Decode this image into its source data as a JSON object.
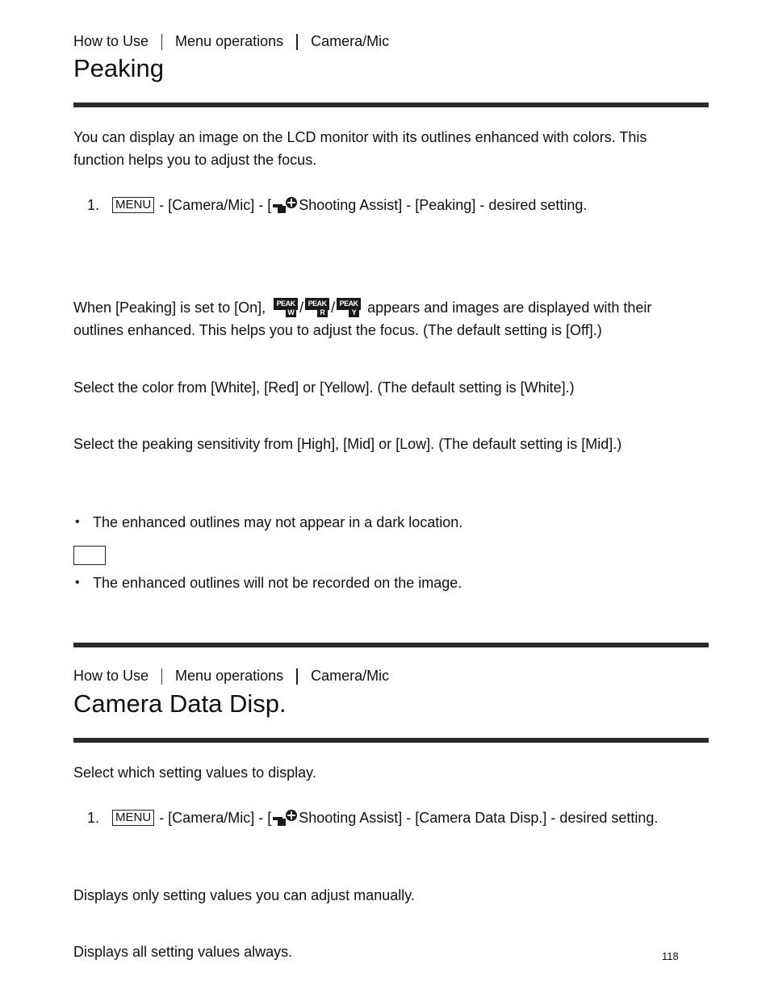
{
  "section1": {
    "breadcrumb": [
      "How to Use",
      "Menu operations",
      "Camera/Mic"
    ],
    "title": "Peaking",
    "intro_line1": "You can display an image on the LCD monitor with its outlines enhanced with colors. This",
    "intro_line2": "function helps you to adjust the focus.",
    "step": {
      "number": "1.",
      "menu_key": "MENU",
      "text_before_icon": "- [Camera/Mic] - [",
      "icon": "shooting-assist-icon",
      "text_after_icon": "Shooting Assist] - [Peaking] - desired setting."
    },
    "on_desc": {
      "prefix": "When [Peaking] is set to [On],",
      "icons": [
        {
          "top": "PEAK",
          "sub": "W",
          "name": "peak-white-icon"
        },
        {
          "top": "PEAK",
          "sub": "R",
          "name": "peak-red-icon"
        },
        {
          "top": "PEAK",
          "sub": "Y",
          "name": "peak-yellow-icon"
        }
      ],
      "slash": "/",
      "suffix": "appears and images are displayed with their",
      "line2": "outlines enhanced. This helps you to adjust the focus. (The default setting is [Off].)"
    },
    "color_desc": "Select the color from [White], [Red] or [Yellow]. (The default setting is [White].)",
    "level_desc": "Select the peaking sensitivity from [High], [Mid] or [Low]. (The default setting is [Mid].)",
    "notes": [
      "The enhanced outlines may not appear in a dark location.",
      "The enhanced outlines will not be recorded on the image."
    ]
  },
  "section2": {
    "breadcrumb": [
      "How to Use",
      "Menu operations",
      "Camera/Mic"
    ],
    "title": "Camera Data Disp.",
    "intro": "Select which setting values to display.",
    "step": {
      "number": "1.",
      "menu_key": "MENU",
      "text_before_icon": "- [Camera/Mic] - [",
      "icon": "shooting-assist-icon",
      "text_after_icon": "Shooting Assist] - [Camera Data Disp.] - desired setting."
    },
    "option1_desc": "Displays only setting values you can adjust manually.",
    "option2_desc": "Displays all setting values always."
  },
  "page_number": "118"
}
